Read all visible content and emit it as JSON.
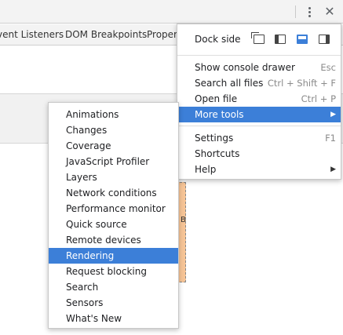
{
  "toolbar": {
    "kebab_icon": "vertical-dots-icon",
    "close_icon": "close-icon",
    "close_glyph": "✕"
  },
  "subtabs": [
    "vent Listeners",
    "DOM Breakpoints",
    "Proper"
  ],
  "box_model": {
    "label": "B"
  },
  "main_menu": {
    "dock_side_label": "Dock side",
    "dock_icons": [
      "undock-icon",
      "dock-left-icon",
      "dock-bottom-icon",
      "dock-right-icon"
    ],
    "items": [
      {
        "label": "Show console drawer",
        "shortcut": "Esc"
      },
      {
        "label": "Search all files",
        "shortcut": "Ctrl + Shift + F"
      },
      {
        "label": "Open file",
        "shortcut": "Ctrl + P"
      },
      {
        "label": "More tools",
        "arrow": "▶"
      },
      {
        "label": "Settings",
        "shortcut": "F1"
      },
      {
        "label": "Shortcuts",
        "shortcut": ""
      },
      {
        "label": "Help",
        "arrow": "▶"
      }
    ]
  },
  "more_tools_menu": {
    "items": [
      "Animations",
      "Changes",
      "Coverage",
      "JavaScript Profiler",
      "Layers",
      "Network conditions",
      "Performance monitor",
      "Quick source",
      "Remote devices",
      "Rendering",
      "Request blocking",
      "Search",
      "Sensors",
      "What's New"
    ],
    "selected": "Rendering"
  },
  "colors": {
    "selection": "#3c7fd8",
    "toolbar_bg": "#f3f3f3",
    "box_model_margin": "#f7c597"
  }
}
